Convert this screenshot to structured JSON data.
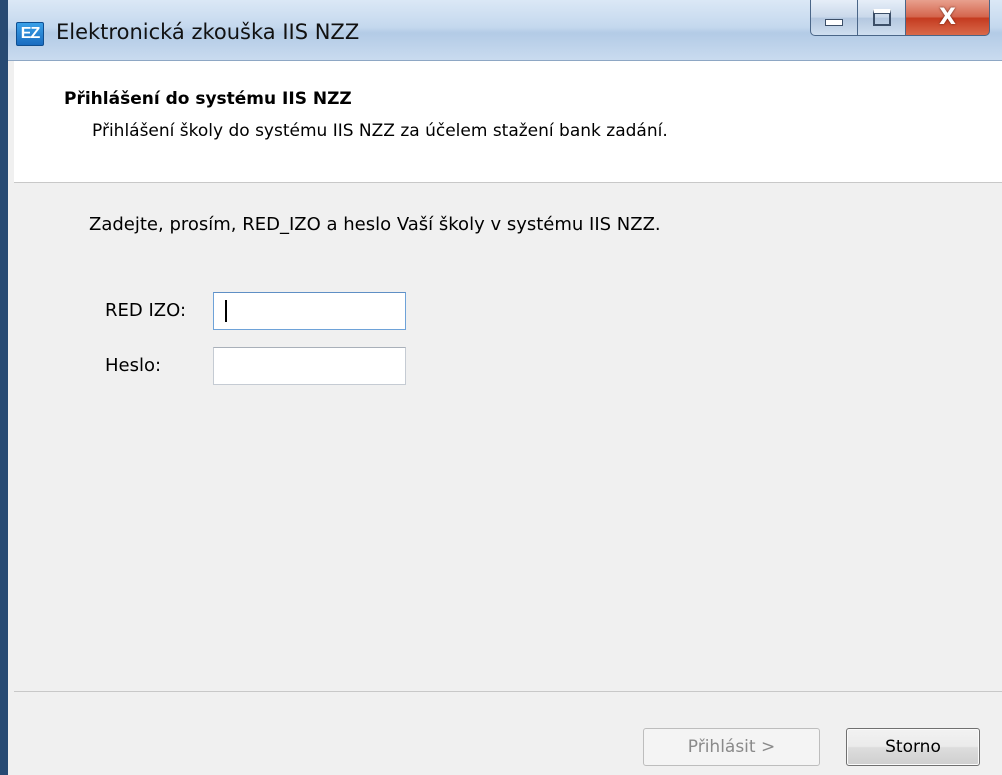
{
  "window": {
    "title": "Elektronická zkouška IIS NZZ",
    "icon_text": "EZ",
    "controls": {
      "minimize_icon": "minimize-icon",
      "maximize_icon": "maximize-icon",
      "close_glyph": "X"
    }
  },
  "header": {
    "title": "Přihlášení do systému IIS NZZ",
    "subtitle": "Přihlášení školy do systému IIS NZZ za účelem stažení bank zadání."
  },
  "form": {
    "instruction": "Zadejte, prosím, RED_IZO a heslo Vaší školy v systému IIS NZZ.",
    "red_izo": {
      "label": "RED IZO:",
      "value": ""
    },
    "password": {
      "label": "Heslo:",
      "value": ""
    }
  },
  "buttons": {
    "login": {
      "label": "Přihlásit >",
      "enabled": false
    },
    "cancel": {
      "label": "Storno",
      "enabled": true
    }
  },
  "colors": {
    "titlebar": "#c4d8ee",
    "close_button": "#c43b20",
    "dialog_background": "#f0f0f0",
    "focus_border": "#6ea2d8"
  }
}
